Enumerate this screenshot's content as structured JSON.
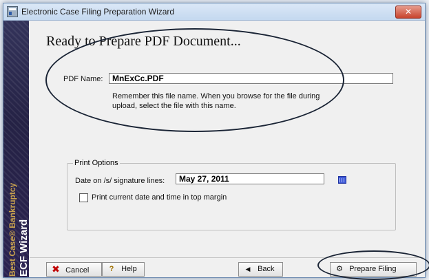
{
  "window": {
    "title": "Electronic Case Filing Preparation Wizard"
  },
  "sidebar": {
    "brand_line1": "Best Case® Bankruptcy",
    "brand_line2": "ECF Wizard"
  },
  "main": {
    "heading": "Ready to Prepare PDF Document...",
    "pdf_name_label": "PDF Name:",
    "pdf_name_value": "MnExCc.PDF",
    "pdf_note": "Remember this file name. When you browse for the file during upload, select the file with this name.",
    "print_options": {
      "title": "Print Options",
      "date_label": "Date on /s/ signature lines:",
      "date_value": "May 27, 2011",
      "checkbox_label": "Print current date and time in top margin"
    }
  },
  "footer": {
    "cancel_label": "Cancel",
    "help_label": "Help",
    "back_label": "Back",
    "prepare_label": "Prepare Filing"
  },
  "colors": {
    "sidebar": "#2a2550",
    "close_button": "#c7432d",
    "accent_gold": "#c8a24e"
  },
  "icons": {
    "app": "app-window-icon",
    "close": "close-icon",
    "cancel": "red-x-icon",
    "help": "question-mark-icon",
    "back": "left-arrow-icon",
    "prepare": "gear-icon",
    "calendar": "calendar-icon"
  }
}
